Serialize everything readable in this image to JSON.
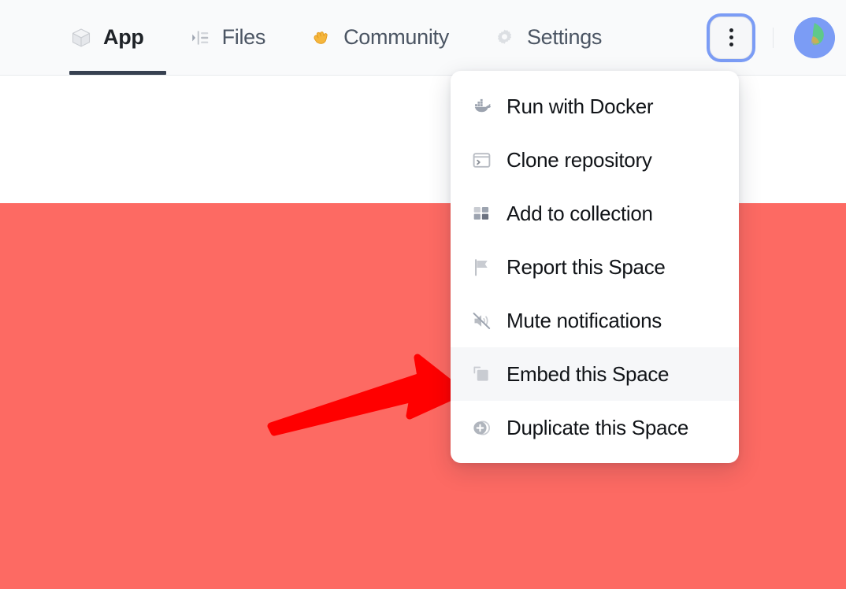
{
  "header": {
    "tabs": [
      {
        "label": "App",
        "icon": "cube-icon",
        "active": true
      },
      {
        "label": "Files",
        "icon": "files-panel-icon",
        "active": false
      },
      {
        "label": "Community",
        "icon": "clapping-hands-icon",
        "active": false
      },
      {
        "label": "Settings",
        "icon": "gear-icon",
        "active": false
      }
    ],
    "overflow_button": {
      "icon": "three-dots-vertical-icon",
      "focused": true
    },
    "avatar": {
      "icon": "user-avatar"
    }
  },
  "menu": {
    "items": [
      {
        "label": "Run with Docker",
        "icon": "docker-whale-icon",
        "hovered": false
      },
      {
        "label": "Clone repository",
        "icon": "terminal-icon",
        "hovered": false
      },
      {
        "label": "Add to collection",
        "icon": "collection-grid-icon",
        "hovered": false
      },
      {
        "label": "Report this Space",
        "icon": "flag-icon",
        "hovered": false
      },
      {
        "label": "Mute notifications",
        "icon": "speaker-mute-icon",
        "hovered": false
      },
      {
        "label": "Embed this Space",
        "icon": "embed-window-icon",
        "hovered": true
      },
      {
        "label": "Duplicate this Space",
        "icon": "duplicate-plus-icon",
        "hovered": false
      }
    ]
  },
  "annotation": {
    "arrow": {
      "name": "red-pointer-arrow",
      "color": "#FF0000",
      "points_to": "Embed this Space"
    }
  },
  "colors": {
    "body_background": "#fd6a63",
    "header_background": "#f9fafb",
    "focus_ring": "#7b9cf5",
    "active_tab_underline": "#374151",
    "menu_hover": "#f6f7f9",
    "arrow_red": "#FF0000"
  }
}
